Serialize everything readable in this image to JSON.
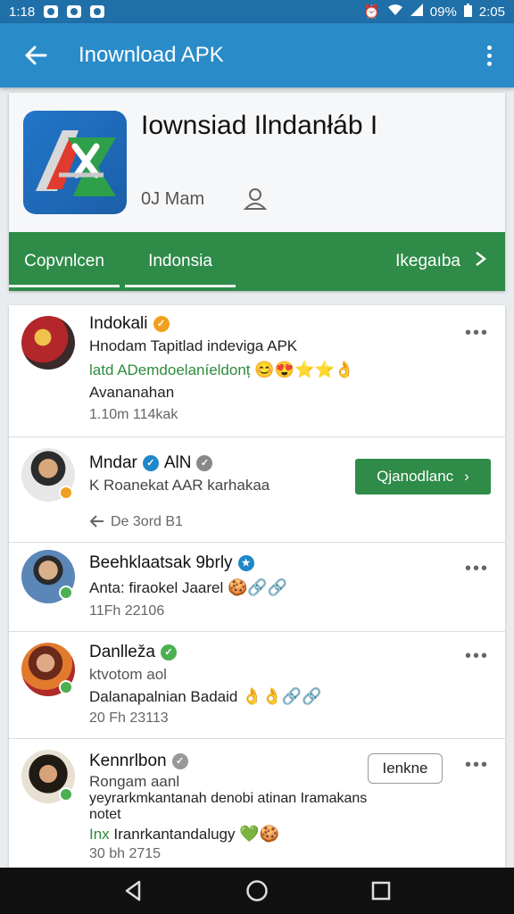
{
  "status": {
    "time_left": "1:18",
    "battery": "09%",
    "time_right": "2:05"
  },
  "appbar": {
    "title": "Inownload APK"
  },
  "app": {
    "title": "Iownsiad Ilndanłáb I",
    "meta": "0J Mam"
  },
  "tabs": [
    {
      "label": "Copvnlcen"
    },
    {
      "label": "Indonsia"
    },
    {
      "label": "Ikegaıba"
    }
  ],
  "posts": [
    {
      "name": "Indokali",
      "line1": "Hnodam Tapitlad indeviga APK",
      "line2": "latd ADemdoelaníeldonț",
      "line2_emoji": "😊😍⭐⭐👌",
      "line3": "Avananahan",
      "meta": "1.10m   114kak"
    },
    {
      "name": "Mndar",
      "name_suffix": "AlN",
      "line1": "K Roanekat AAR karhakaa",
      "meta": "De   3ord B1",
      "button": "Qjanodlanc"
    },
    {
      "name": "Beehklaatsak 9brly",
      "line1": "Anta: firaokel Jaarel",
      "line1_emoji": "🍪🔗🔗",
      "meta": "11Fh   22106"
    },
    {
      "name": "Danlleža",
      "line1": "ktvotom aol",
      "line2": "Dalanapalnian Badaid",
      "line2_emoji": "👌👌🔗🔗",
      "meta": "20 Fh   23113"
    },
    {
      "name": "Kennrlbon",
      "line1": "Rongam aanl",
      "line2": "yeyrarkmkantanah denobi atinan Iramakans",
      "line3": "notet",
      "line4_green": "Inx",
      "line4": "Iranrkantandalugy",
      "line4_emoji": "💚🍪",
      "meta": "30 bh   2715",
      "button": "Ienkne"
    }
  ],
  "colors": {
    "appbar": "#2a8bc9",
    "tabbar": "#2e8b48",
    "accent": "#2e8b48"
  }
}
